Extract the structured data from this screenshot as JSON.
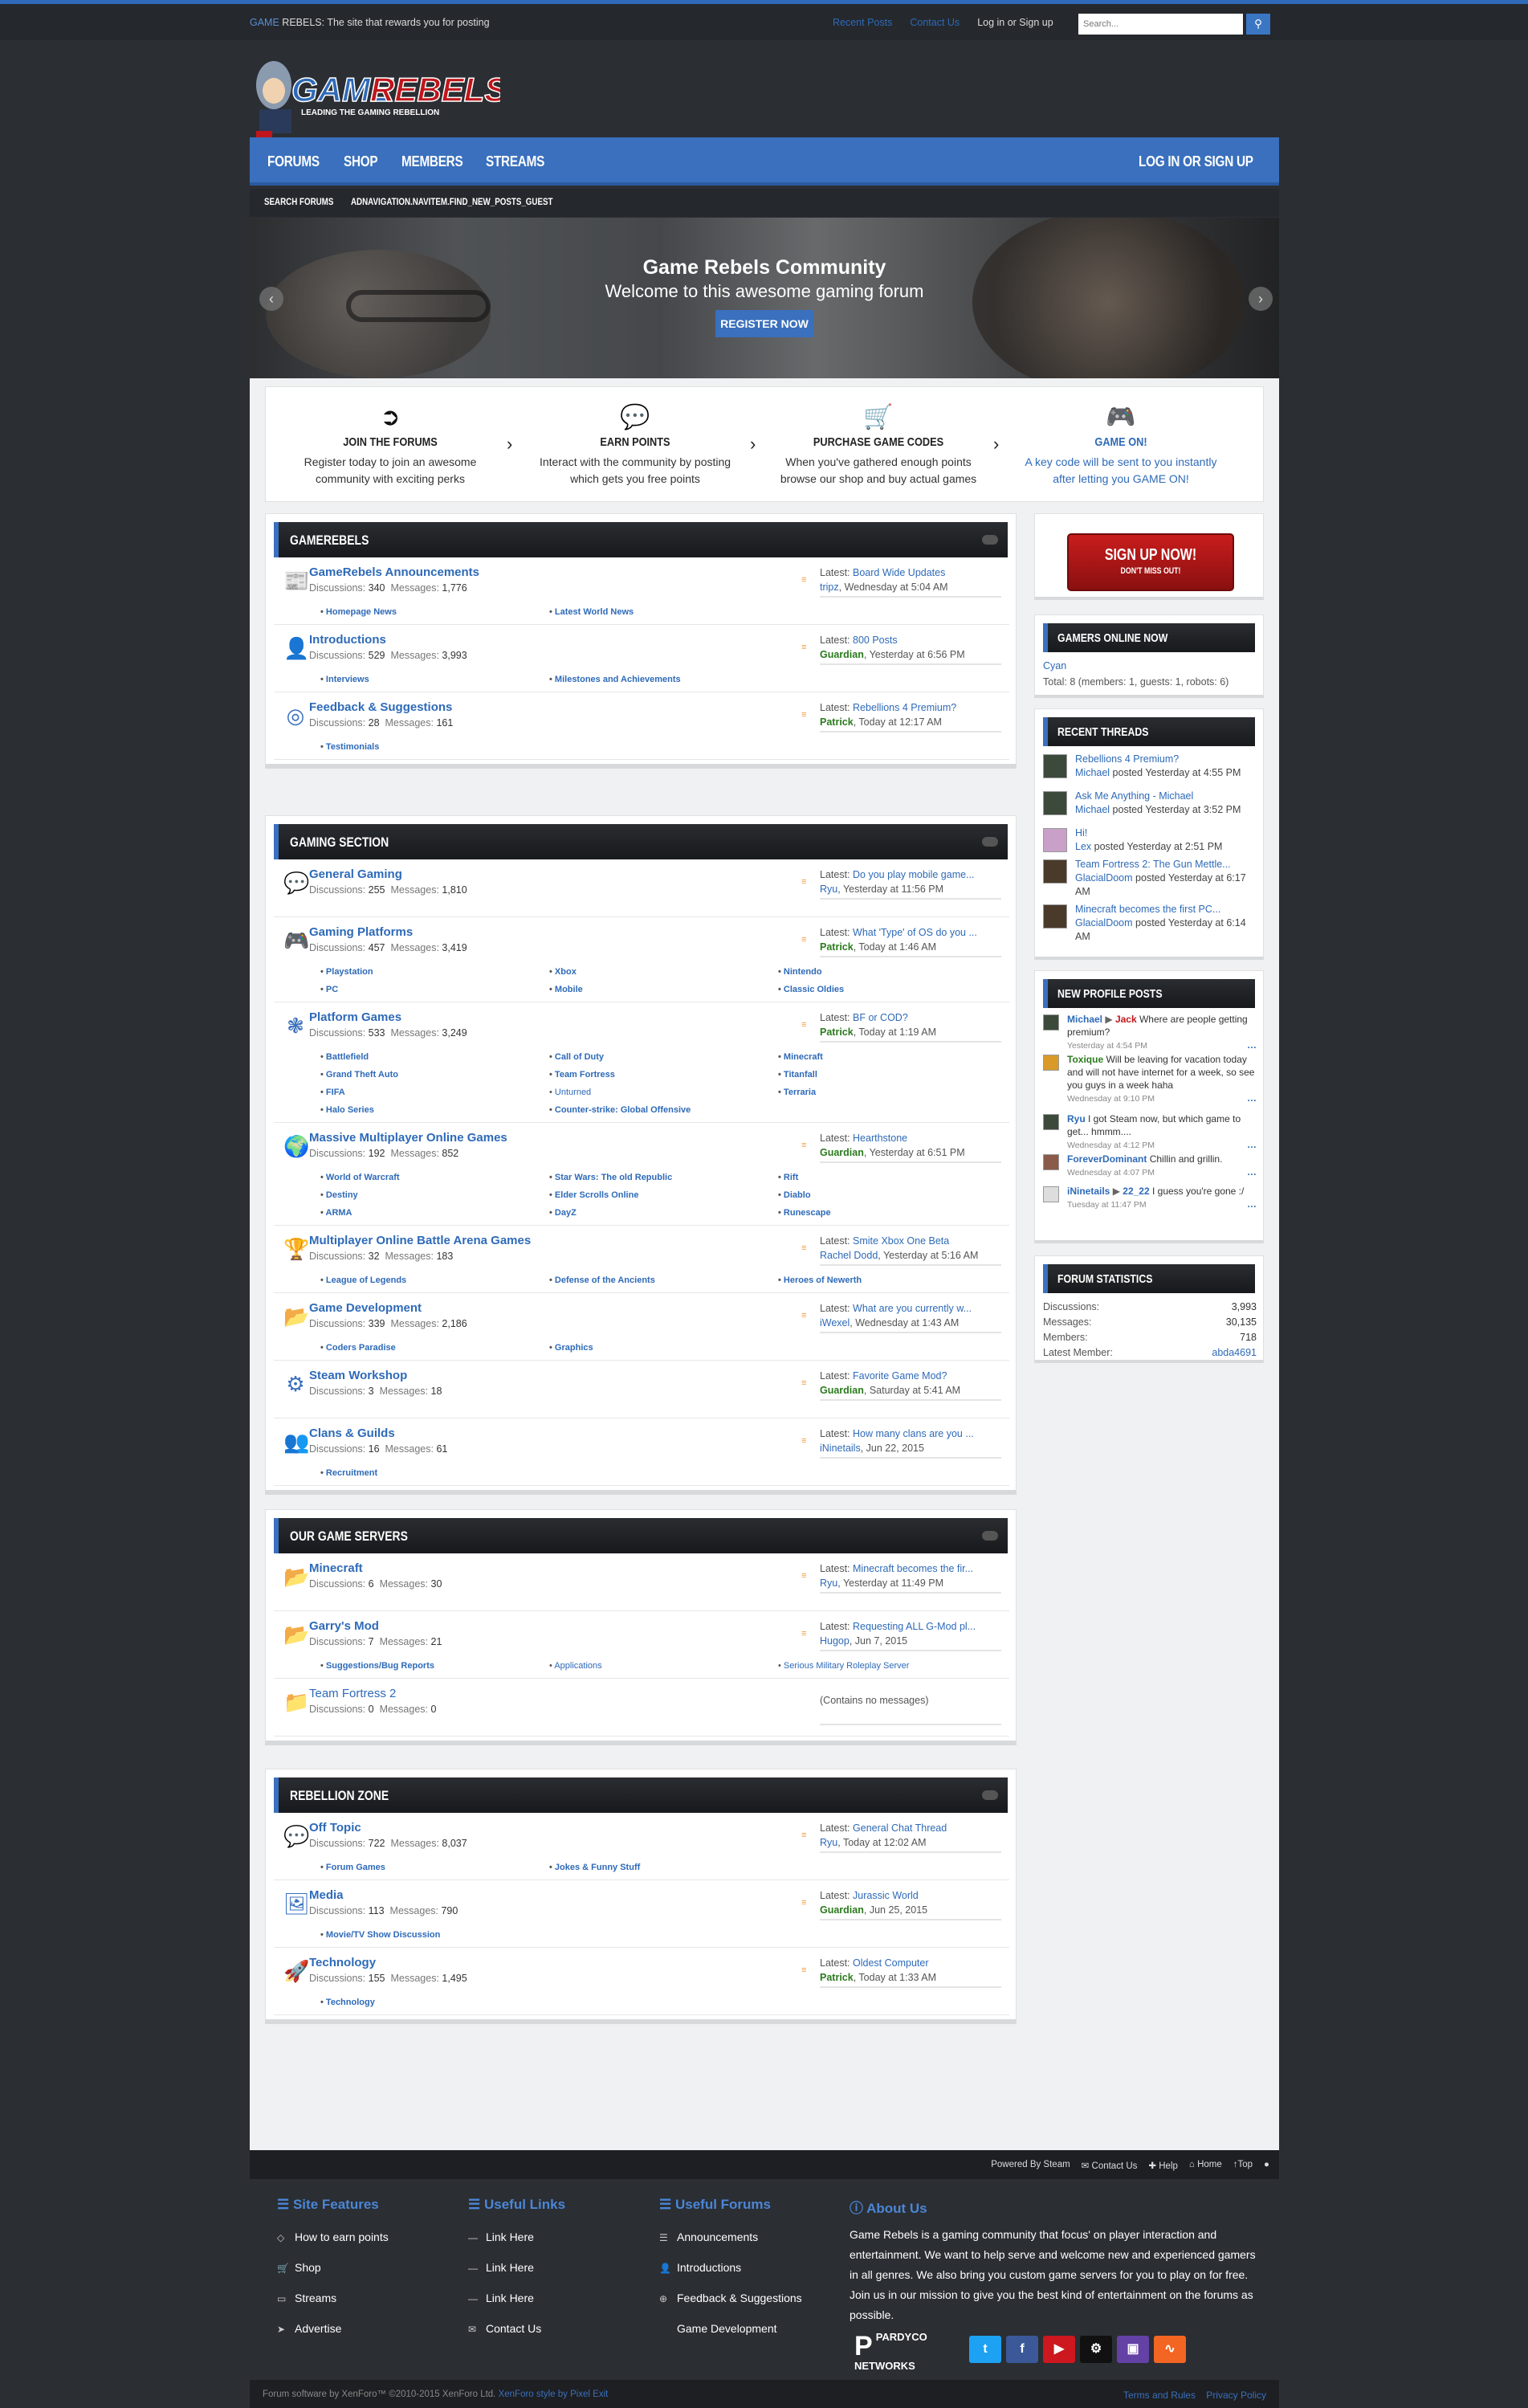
{
  "topbar": {
    "tagline_brand_a": "GAME",
    "tagline_brand_b": " REBELS",
    "tagline_text": ": The site that rewards you for posting",
    "links": [
      "Recent Posts",
      "Contact Us",
      "Log in or Sign up"
    ],
    "search_placeholder": "Search..."
  },
  "logo": {
    "text_a": "GAME",
    "text_b": "REBELS",
    "sub": "LEADING THE GAMING REBELLION"
  },
  "nav": {
    "items": [
      "FORUMS",
      "SHOP",
      "MEMBERS",
      "STREAMS"
    ],
    "login": "LOG IN OR SIGN UP"
  },
  "subnav": {
    "items": [
      "SEARCH FORUMS",
      "ADNAVIGATION.NAVITEM.FIND_NEW_POSTS_GUEST"
    ]
  },
  "slider": {
    "title": "Game Rebels Community",
    "subtitle": "Welcome to this awesome gaming forum",
    "button": "REGISTER NOW"
  },
  "steps": [
    {
      "title": "JOIN THE FORUMS",
      "text": "Register today to join an awesome community with exciting perks",
      "icon": "sign-in-icon"
    },
    {
      "title": "EARN POINTS",
      "text": "Interact with the community by posting which gets you free points",
      "icon": "comments-icon"
    },
    {
      "title": "PURCHASE GAME CODES",
      "text": "When you've gathered enough points browse our shop and buy actual games",
      "icon": "cart-icon"
    },
    {
      "title": "GAME ON!",
      "text": "A key code will be sent to you instantly after letting you GAME ON!",
      "icon": "gamepad-icon"
    }
  ],
  "labels": {
    "discussions": "Discussions:",
    "messages": "Messages:",
    "latest": "Latest:",
    "contains_none": "(Contains no messages)"
  },
  "categories": [
    {
      "title": "GAMEREBELS",
      "forums": [
        {
          "name": "GameRebels Announcements",
          "d": "340",
          "m": "1,776",
          "icon": "news-icon",
          "latest": "Board Wide Updates",
          "user": "tripz",
          "time": ", Wednesday at 5:04 AM",
          "subs": [
            "Homepage News",
            "Latest World News"
          ]
        },
        {
          "name": "Introductions",
          "d": "529",
          "m": "3,993",
          "icon": "user-add-icon",
          "latest": "800 Posts",
          "user": "Guardian",
          "time": ", Yesterday at 6:56 PM",
          "subs": [
            "Interviews",
            "Milestones and Achievements"
          ]
        },
        {
          "name": "Feedback & Suggestions",
          "d": "28",
          "m": "161",
          "icon": "lifebuoy-icon",
          "latest": "Rebellions 4 Premium?",
          "user": "Patrick",
          "time": ", Today at 12:17 AM",
          "subs": [
            "Testimonials"
          ]
        }
      ]
    },
    {
      "title": "GAMING SECTION",
      "forums": [
        {
          "name": "General Gaming",
          "d": "255",
          "m": "1,810",
          "icon": "comments-icon",
          "latest": "Do you play mobile game...",
          "user": "Ryu",
          "time": ", Yesterday at 11:56 PM",
          "subs": []
        },
        {
          "name": "Gaming Platforms",
          "d": "457",
          "m": "3,419",
          "icon": "gamepad-icon",
          "latest": "What 'Type' of OS do you ...",
          "user": "Patrick",
          "time": ", Today at 1:46 AM",
          "subs": [
            "Playstation",
            "Xbox",
            "Nintendo",
            "PC",
            "Mobile",
            "Classic Oldies"
          ]
        },
        {
          "name": "Platform Games",
          "d": "533",
          "m": "3,249",
          "icon": "rebel-icon",
          "latest": "BF or COD?",
          "user": "Patrick",
          "time": ", Today at 1:19 AM",
          "subs": [
            "Battlefield",
            "Call of Duty",
            "Minecraft",
            "Grand Theft Auto",
            "Team Fortress",
            "Titanfall",
            "FIFA",
            "Unturned",
            "Terraria",
            "Halo Series",
            "Counter-strike: Global Offensive"
          ]
        },
        {
          "name": "Massive Multiplayer Online Games",
          "d": "192",
          "m": "852",
          "icon": "globe-icon",
          "latest": "Hearthstone",
          "user": "Guardian",
          "time": ", Yesterday at 6:51 PM",
          "subs": [
            "World of Warcraft",
            "Star Wars: The old Republic",
            "Rift",
            "Destiny",
            "Elder Scrolls Online",
            "Diablo",
            "ARMA",
            "DayZ",
            "Runescape"
          ]
        },
        {
          "name": "Multiplayer Online Battle Arena Games",
          "d": "32",
          "m": "183",
          "icon": "trophy-icon",
          "latest": "Smite Xbox One Beta",
          "user": "Rachel Dodd",
          "time": ", Yesterday at 5:16 AM",
          "subs": [
            "League of Legends",
            "Defense of the Ancients",
            "Heroes of Newerth"
          ]
        },
        {
          "name": "Game Development",
          "d": "339",
          "m": "2,186",
          "icon": "folder-open-icon",
          "latest": "What are you currently w...",
          "user": "iWexel",
          "time": ", Wednesday at 1:43 AM",
          "subs": [
            "Coders Paradise",
            "Graphics"
          ]
        },
        {
          "name": "Steam Workshop",
          "d": "3",
          "m": "18",
          "icon": "steam-icon",
          "latest": "Favorite Game Mod?",
          "user": "Guardian",
          "time": ", Saturday at 5:41 AM",
          "subs": []
        },
        {
          "name": "Clans & Guilds",
          "d": "16",
          "m": "61",
          "icon": "users-icon",
          "latest": "How many clans are you ...",
          "user": "iNinetails",
          "time": ", Jun 22, 2015",
          "subs": [
            "Recruitment"
          ]
        }
      ]
    },
    {
      "title": "OUR GAME SERVERS",
      "forums": [
        {
          "name": "Minecraft",
          "d": "6",
          "m": "30",
          "icon": "folder-open-icon",
          "latest": "Minecraft becomes the fir...",
          "user": "Ryu",
          "time": ", Yesterday at 11:49 PM",
          "subs": []
        },
        {
          "name": "Garry's Mod",
          "d": "7",
          "m": "21",
          "icon": "folder-open-icon",
          "latest": "Requesting ALL G-Mod pl...",
          "user": "Hugop",
          "time": ", Jun 7, 2015",
          "subs": [
            "Suggestions/Bug Reports",
            "Applications",
            "Serious Military Roleplay Server"
          ]
        },
        {
          "name": "Team Fortress 2",
          "d": "0",
          "m": "0",
          "icon": "folder-icon",
          "latest": "",
          "user": "",
          "time": "",
          "subs": []
        }
      ]
    },
    {
      "title": "REBELLION ZONE",
      "forums": [
        {
          "name": "Off Topic",
          "d": "722",
          "m": "8,037",
          "icon": "comments-icon",
          "latest": "General Chat Thread",
          "user": "Ryu",
          "time": ", Today at 12:02 AM",
          "subs": [
            "Forum Games",
            "Jokes & Funny Stuff"
          ]
        },
        {
          "name": "Media",
          "d": "113",
          "m": "790",
          "icon": "image-icon",
          "latest": "Jurassic World",
          "user": "Guardian",
          "time": ", Jun 25, 2015",
          "subs": [
            "Movie/TV Show Discussion"
          ]
        },
        {
          "name": "Technology",
          "d": "155",
          "m": "1,495",
          "icon": "rocket-icon",
          "latest": "Oldest Computer",
          "user": "Patrick",
          "time": ", Today at 1:33 AM",
          "subs": [
            "Technology"
          ]
        }
      ]
    }
  ],
  "sidebar": {
    "signup_a": "SIGN UP NOW!",
    "signup_b": "DON'T MISS OUT!",
    "online_title": "GAMERS ONLINE NOW",
    "online_user": "Cyan",
    "online_total": "Total: 8 (members: 1, guests: 1, robots: 6)",
    "threads_title": "RECENT THREADS",
    "threads": [
      {
        "title": "Rebellions 4 Premium?",
        "user": "Michael",
        "time": " posted Yesterday at 4:55 PM"
      },
      {
        "title": "Ask Me Anything - Michael",
        "user": "Michael",
        "time": " posted Yesterday at 3:52 PM"
      },
      {
        "title": "Hi!",
        "user": "Lex",
        "time": " posted Yesterday at 2:51 PM"
      },
      {
        "title": "Team Fortress 2: The Gun Mettle...",
        "user": "GlacialDoom",
        "time": " posted Yesterday at 6:17 AM"
      },
      {
        "title": "Minecraft becomes the first PC...",
        "user": "GlacialDoom",
        "time": " posted Yesterday at 6:14 AM"
      }
    ],
    "profile_title": "NEW PROFILE POSTS",
    "profile": [
      {
        "user": "Michael",
        "to": "Jack",
        "text": " Where are people getting premium?",
        "time": "Yesterday at 4:54 PM"
      },
      {
        "user": "Toxique",
        "to": "",
        "text": " Will be leaving for vacation today and will not have internet for a week, so see you guys in a week haha",
        "time": "Wednesday at 9:10 PM"
      },
      {
        "user": "Ryu",
        "to": "",
        "text": " I got Steam now, but which game to get... hmmm....",
        "time": "Wednesday at 4:12 PM"
      },
      {
        "user": "ForeverDominant",
        "to": "",
        "text": " Chillin and grillin.",
        "time": "Wednesday at 4:07 PM"
      },
      {
        "user": "iNinetails",
        "to": "22_22",
        "text": " I guess you're gone :/",
        "time": "Tuesday at 11:47 PM"
      }
    ],
    "stats_title": "FORUM STATISTICS",
    "stats": [
      [
        "Discussions:",
        "3,993"
      ],
      [
        "Messages:",
        "30,135"
      ],
      [
        "Members:",
        "718"
      ],
      [
        "Latest Member:",
        "abda4691"
      ]
    ]
  },
  "bottombar": [
    "Powered By Steam",
    "Contact Us",
    "Help",
    "Home",
    "Top"
  ],
  "footer": {
    "cols": [
      {
        "title": "Site Features",
        "items": [
          "How to earn points",
          "Shop",
          "Streams",
          "Advertise"
        ]
      },
      {
        "title": "Useful Links",
        "items": [
          "Link Here",
          "Link Here",
          "Link Here",
          "Contact Us"
        ]
      },
      {
        "title": "Useful Forums",
        "items": [
          "Announcements",
          "Introductions",
          "Feedback & Suggestions",
          "Game Development"
        ]
      }
    ],
    "about_title": "About Us",
    "about_text": "Game Rebels is a gaming community that focus' on player interaction and entertainment. We want to help serve and welcome new and experienced gamers in all genres. We also bring you custom game servers for you to play on for free. Join us in our mission to give you the best kind of entertainment on the forums as possible.",
    "pardy_a": "PARDYCO",
    "pardy_b": "NETWORKS"
  },
  "copyright": {
    "text": "Forum software by XenForo™ ©2010-2015 XenForo Ltd. ",
    "style": "XenForo style by Pixel Exit",
    "links": "Terms and Rules    Privacy Policy"
  }
}
